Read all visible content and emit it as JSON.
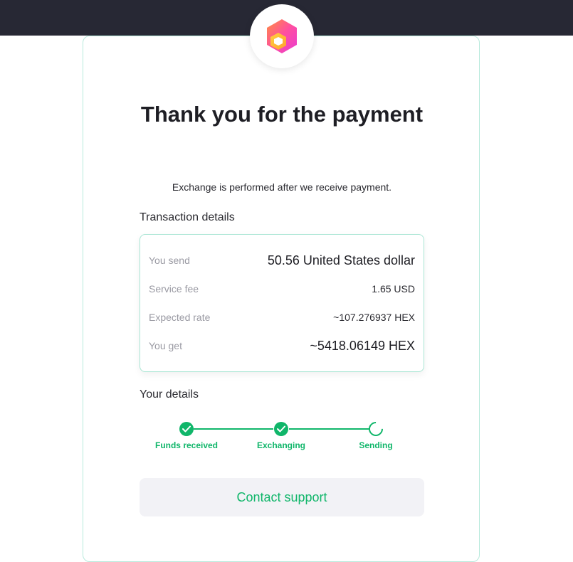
{
  "header": {
    "logo_icon": "hex-logo-icon"
  },
  "main": {
    "title": "Thank you for the payment",
    "subtitle": "Exchange is performed after we receive payment."
  },
  "transaction": {
    "heading": "Transaction details",
    "you_send_label": "You send",
    "you_send_value": "50.56 United States dollar",
    "service_fee_label": "Service fee",
    "service_fee_value": "1.65 USD",
    "expected_rate_label": "Expected rate",
    "expected_rate_value": "~107.276937 HEX",
    "you_get_label": "You get",
    "you_get_value": "~5418.06149 HEX"
  },
  "your_details": {
    "heading": "Your details",
    "steps": [
      {
        "label": "Funds received",
        "status": "done"
      },
      {
        "label": "Exchanging",
        "status": "done"
      },
      {
        "label": "Sending",
        "status": "in-progress"
      }
    ]
  },
  "actions": {
    "contact_support": "Contact support"
  },
  "colors": {
    "accent": "#10b66a",
    "topbar": "#272834",
    "card_border": "#b8eadc"
  }
}
